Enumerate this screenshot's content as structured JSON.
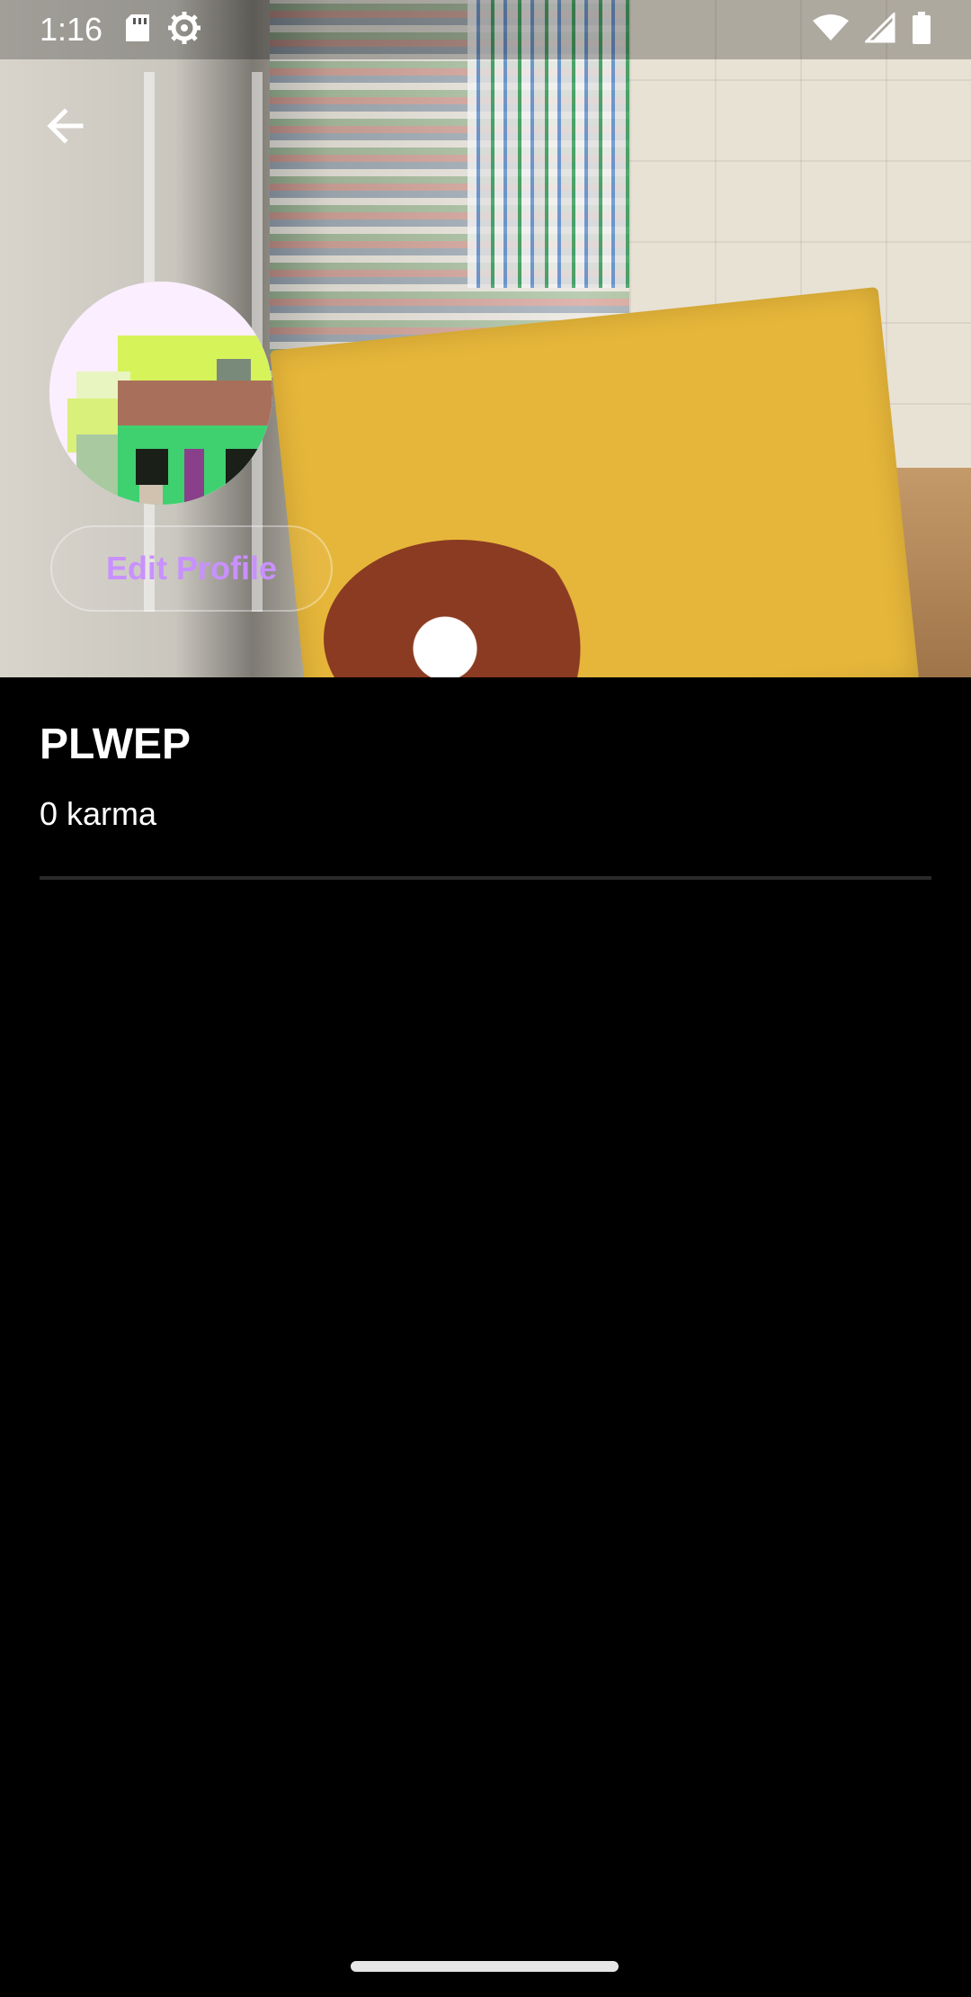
{
  "status_bar": {
    "time": "1:16",
    "icons": [
      "sd-card-icon",
      "settings-icon",
      "wifi-icon",
      "signal-icon",
      "battery-icon"
    ]
  },
  "header": {
    "back_icon": "arrow-back-icon",
    "banner_image": "bookstore-photo",
    "avatar_image": "pixel-avatar"
  },
  "profile": {
    "edit_button_label": "Edit Profile",
    "username": "PLWEP",
    "karma": "0 karma"
  },
  "colors": {
    "background": "#000000",
    "accent": "#c990ff",
    "divider": "#2a2a2a"
  }
}
